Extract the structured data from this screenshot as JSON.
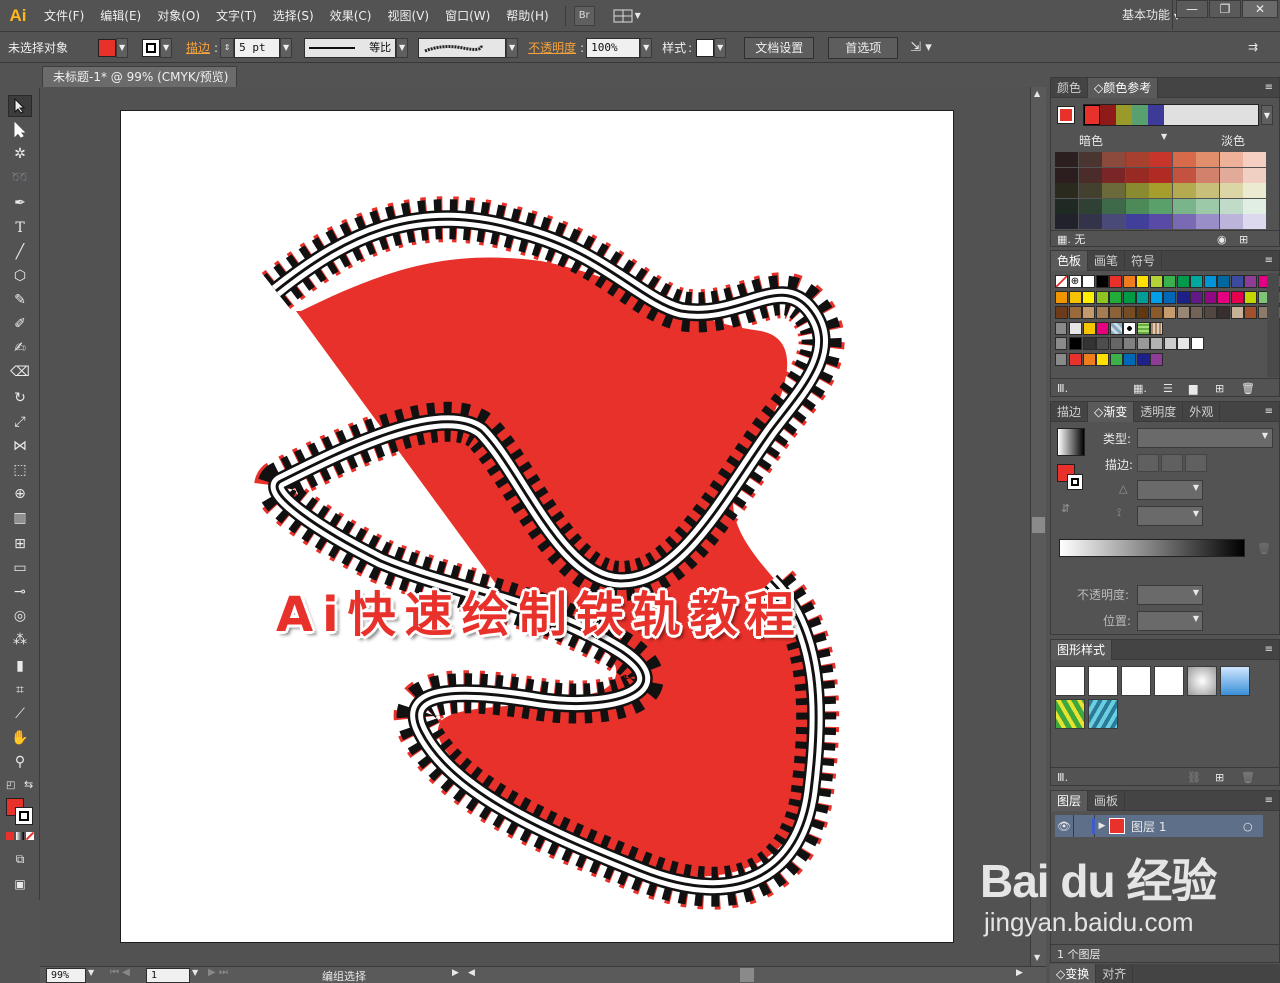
{
  "app": {
    "logo": "Ai",
    "menus": [
      "文件(F)",
      "编辑(E)",
      "对象(O)",
      "文字(T)",
      "选择(S)",
      "效果(C)",
      "视图(V)",
      "窗口(W)",
      "帮助(H)"
    ],
    "bridge_button": "Br",
    "workspace": "基本功能",
    "window_buttons": [
      "—",
      "❐",
      "✕"
    ]
  },
  "control": {
    "selection_label": "未选择对象",
    "stroke_label": "描边",
    "stroke_value": "5 pt",
    "profile_label": "等比",
    "opacity_label": "不透明度",
    "opacity_value": "100%",
    "style_label": "样式",
    "doc_setup_button": "文档设置",
    "prefs_button": "首选项",
    "fill_color": "#e8312a"
  },
  "document": {
    "tab_title": "未标题-1* @ 99% (CMYK/预览)",
    "tab_close": "✕",
    "headline": "Ai快速绘制铁轨教程",
    "art_red": "#e8312a"
  },
  "status": {
    "zoom": "99%",
    "page": "1",
    "mode": "编组选择"
  },
  "panels": {
    "color_tabs": [
      "颜色",
      "颜色参考"
    ],
    "guide_left": "暗色",
    "guide_right": "淡色",
    "guide_footer": "无",
    "swatch_tabs": [
      "色板",
      "画笔",
      "符号"
    ],
    "gradient_tabs": [
      "描边",
      "渐变",
      "透明度",
      "外观"
    ],
    "gradient_type_label": "类型",
    "gradient_stroke_label": "描边",
    "gradient_opacity_label": "不透明度",
    "gradient_position_label": "位置",
    "graphic_styles_tab": "图形样式",
    "layers_tabs": [
      "图层",
      "画板"
    ],
    "layer_name": "图层 1",
    "layers_count": "1 个图层",
    "bottom_tabs": [
      "变换",
      "对齐"
    ]
  },
  "watermark": {
    "brand": "Bai du 经验",
    "url": "jingyan.baidu.com"
  },
  "guide_colors": [
    [
      "#2b1f1f",
      "#4a3530",
      "#8b4a3c",
      "#a8402f",
      "#c8362b",
      "#d86a4c",
      "#e08e6c",
      "#eeb29a",
      "#f5d0c2"
    ],
    [
      "#2c1e1e",
      "#4b2c2a",
      "#7b2626",
      "#972b24",
      "#b22a24",
      "#c45240",
      "#d2826c",
      "#e2aa98",
      "#f1d0c4"
    ],
    [
      "#2a2a1e",
      "#434030",
      "#6a6a3a",
      "#8a8a30",
      "#a59e2c",
      "#b4aa50",
      "#c8c07a",
      "#dcd6a6",
      "#ecead0"
    ],
    [
      "#1f2a24",
      "#2f4034",
      "#3e6a4a",
      "#4c8a5a",
      "#5aa06a",
      "#7ab48a",
      "#9ccaa8",
      "#c0dcc8",
      "#e0eee4"
    ],
    [
      "#22222c",
      "#33334a",
      "#4a4a78",
      "#40409a",
      "#5a4aa8",
      "#7a6ab6",
      "#9a8ec8",
      "#bcb4da",
      "#dcd8ee"
    ]
  ],
  "swatch_rows": [
    [
      "none",
      "reg",
      "#ffffff",
      "#000000",
      "#e8312a",
      "#ef7d1e",
      "#ffe000",
      "#b5d334",
      "#3cb04a",
      "#009a4a",
      "#00a99d",
      "#0095d9",
      "#00689f",
      "#3b4ca0",
      "#8e3c96",
      "#e40086",
      "#d9186b",
      "#e8312a"
    ],
    [
      "#f29600",
      "#f4c400",
      "#ffef00",
      "#8fc31f",
      "#22ac38",
      "#009944",
      "#009e96",
      "#00a0e9",
      "#0068b7",
      "#1d2088",
      "#601986",
      "#920783",
      "#e4007f",
      "#e5004f",
      "#c3d600",
      "#7dc478",
      "#8e4c1e",
      "#b05f3c"
    ],
    [
      "#6d3b1a",
      "#9b6a3a",
      "#c49a6c",
      "#a67c52",
      "#8c6239",
      "#754c24",
      "#603913",
      "#8b5a2b",
      "#c69c6d",
      "#998675",
      "#736357",
      "#534741",
      "#362f2d",
      "#c7b299",
      "#a0522d",
      "#8c7a6b",
      "#6b5e52",
      "#4a3f36"
    ],
    [
      "#e6e6e6",
      "#f7c400",
      "#e4007f",
      "pat1",
      "pat2",
      "pat3",
      "pat4"
    ],
    [
      "#000000",
      "#333333",
      "#4d4d4d",
      "#666666",
      "#808080",
      "#999999",
      "#b3b3b3",
      "#cccccc",
      "#e6e6e6",
      "#ffffff"
    ],
    [
      "#e8312a",
      "#ef7d1e",
      "#ffe000",
      "#3cb04a",
      "#0068b7",
      "#1d2088",
      "#8e3c96"
    ]
  ],
  "graphic_styles": [
    "default",
    "nofill",
    "white",
    "redslash",
    "gray",
    "blue",
    "green",
    "teal"
  ]
}
